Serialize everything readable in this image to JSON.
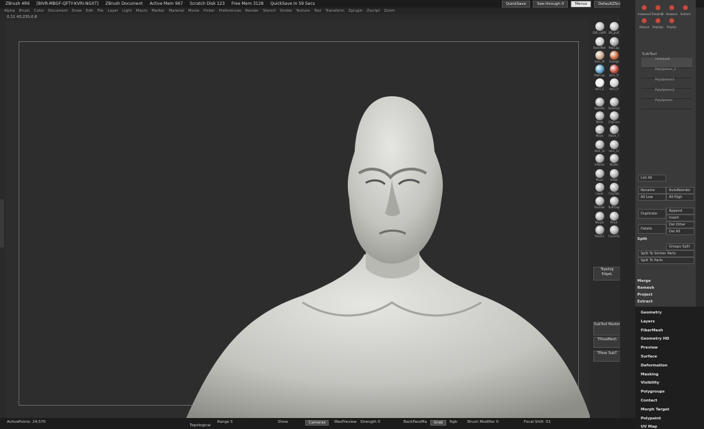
{
  "titlebar": {
    "app": "ZBrush 4R6",
    "serial": "[BIVR-MBGF-QFTY-KVRI-NGXT]",
    "doc": "ZBrush Document",
    "active_mem": "Active Mem 967",
    "scratch": "Scratch Disk 123",
    "free_mem": "Free Mem 3128",
    "quicksave_in": "QuickSave In 59 Secs",
    "quicksave_btn": "QuickSave",
    "see_through": "See-through  0",
    "menus_btn": "Menus",
    "script_btn": "DefaultZScript"
  },
  "menubar": [
    "Alpha",
    "Brush",
    "Color",
    "Document",
    "Draw",
    "Edit",
    "File",
    "Layer",
    "Light",
    "Macro",
    "Marker",
    "Material",
    "Movie",
    "Picker",
    "Preferences",
    "Render",
    "Stencil",
    "Stroke",
    "Texture",
    "Tool",
    "Transform",
    "Zplugin",
    "Zscript",
    "Zoom"
  ],
  "coords": "0.11 43,235,0.8",
  "brushes": [
    {
      "label": "DW_vaBR",
      "color": "#bfbfbf"
    },
    {
      "label": "BB_puff",
      "color": "#bfbfbf"
    },
    {
      "label": "BasicMat",
      "color": "#c9c9c9"
    },
    {
      "label": "MatCap",
      "color": "#a8a8a8"
    },
    {
      "label": "ders_M",
      "color": "#c9a38a"
    },
    {
      "label": "Orange",
      "color": "#c96a3a"
    },
    {
      "label": "MatCap",
      "color": "#5aa0c8"
    },
    {
      "label": "ders_Tr",
      "color": "#c84a3a"
    },
    {
      "label": "ders_E",
      "color": "#f0f0f0"
    },
    {
      "label": "ders_P",
      "color": "#d0d0d0"
    },
    {
      "label": "MaskPe",
      "color": "#b0b0b0"
    },
    {
      "label": "SelectLa",
      "color": "#b0b0b0"
    },
    {
      "label": "Mask",
      "color": "#b0b0b0"
    },
    {
      "label": "ClipCurv",
      "color": "#b0b0b0"
    },
    {
      "label": "Move",
      "color": "#b0b0b0"
    },
    {
      "label": "Move_T",
      "color": "#b0b0b0"
    },
    {
      "label": "dam_St",
      "color": "#b0b0b0"
    },
    {
      "label": "ders_Cr",
      "color": "#b0b0b0"
    },
    {
      "label": "hPolish",
      "color": "#b0b0b0"
    },
    {
      "label": "Mallet",
      "color": "#b0b0b0"
    },
    {
      "label": "Move",
      "color": "#b0b0b0"
    },
    {
      "label": "Inflat",
      "color": "#b0b0b0"
    },
    {
      "label": "Layer",
      "color": "#b0b0b0"
    },
    {
      "label": "ClayTub",
      "color": "#b0b0b0"
    },
    {
      "label": "Standar",
      "color": "#b0b0b0"
    },
    {
      "label": "SoftClay",
      "color": "#b0b0b0"
    },
    {
      "label": "Morph",
      "color": "#b0b0b0"
    },
    {
      "label": "Pinch",
      "color": "#b0b0b0"
    },
    {
      "label": "Slash2",
      "color": "#b0b0b0"
    },
    {
      "label": "CurveTu",
      "color": "#b0b0b0"
    }
  ],
  "tray": {
    "topolog": "Topolog",
    "edge": "EdgeL",
    "subtool_master": "SubTool Master",
    "tpose_mesh": "TPoseMesh",
    "tpose_sub": "TPose SubT"
  },
  "rightpanel": {
    "subtool_title": "SubTool",
    "subtools": [
      "Inkwave2",
      "PolySphere_1",
      "PolySphere1",
      "PolySphere2",
      "PolySphere"
    ],
    "list_all": "List All",
    "rename": "Rename",
    "autoreorder": "AutoReorder",
    "all_low": "All Low",
    "all_high": "All High",
    "duplicate": "Duplicate",
    "append": "Append",
    "insert": "Insert",
    "del_other": "Del Other",
    "delete": "Delete",
    "del_all": "Del All",
    "split": "Split",
    "groups_split": "Groups Split",
    "split_similar": "Split To Similar Parts",
    "split_parts": "Split To Parts",
    "merge": "Merge",
    "remesh": "Remesh",
    "project": "Project",
    "extract": "Extract",
    "top_tools": [
      "Inkwave2",
      "SimpleBr",
      "Inkwave",
      "Extract",
      "AHacet",
      "PolySph",
      "PolyQu"
    ]
  },
  "menu_items": [
    "Geometry",
    "Layers",
    "FiberMesh",
    "Geometry HD",
    "Preview",
    "Surface",
    "Deformation",
    "Masking",
    "Visibility",
    "Polygroups",
    "Contact",
    "Morph Target",
    "Polypaint",
    "UV Map"
  ],
  "status": {
    "active_points": "ActivePoints: 24,570",
    "topological": "Topological",
    "range": "Range 5",
    "show": "Show",
    "cameras": "Cameras",
    "waspreview": "WasPreview",
    "strength": "Strength 0",
    "backfacemask": "BackFaceMa",
    "grab": "Grab",
    "rgb": "Rgb",
    "brush_modifier": "Brush Modifier  0",
    "focal_shift": "Focal Shift -51"
  },
  "colors": {
    "accent": "#e8e8e8",
    "menu_bg": "#1e1e1e",
    "panel": "#3a3a3a"
  }
}
